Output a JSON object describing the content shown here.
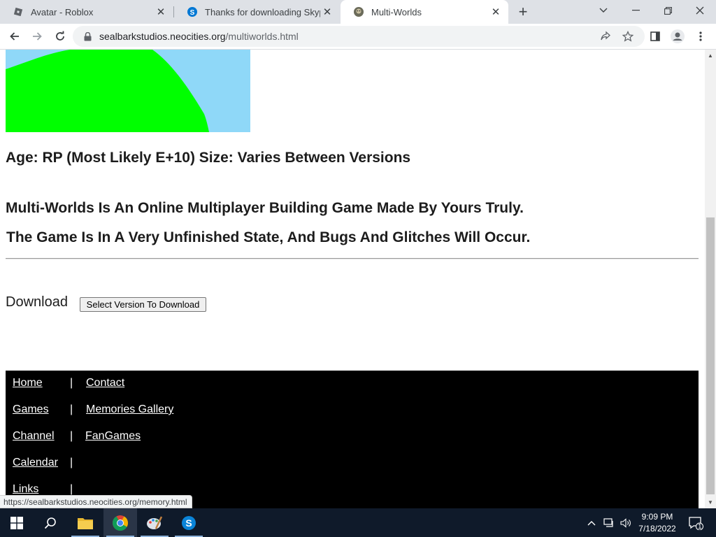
{
  "browser": {
    "tabs": [
      {
        "title": "Avatar - Roblox",
        "icon": "roblox-icon"
      },
      {
        "title": "Thanks for downloading Skype",
        "icon": "skype-icon"
      },
      {
        "title": "Multi-Worlds",
        "icon": "site-favicon",
        "active": true
      }
    ],
    "url_host": "sealbarkstudios.neocities.org",
    "url_path": "/multiworlds.html",
    "status_url": "https://sealbarkstudios.neocities.org/memory.html"
  },
  "page": {
    "info_line": "Age: RP (Most Likely E+10) Size: Varies Between Versions",
    "description_1": "Multi-Worlds Is An Online Multiplayer Building Game Made By Yours Truly.",
    "description_2": "The Game Is In A Very Unfinished State, And Bugs And Glitches Will Occur.",
    "download_label": "Download",
    "download_button": "Select Version To Download",
    "footer_separator": "|",
    "footer_links": {
      "col1": [
        "Home",
        "Games",
        "Channel",
        "Calendar",
        "Links"
      ],
      "col2": [
        "Contact",
        "Memories Gallery",
        "FanGames"
      ]
    }
  },
  "taskbar": {
    "time": "9:09 PM",
    "date": "7/18/2022",
    "notification_count": "1"
  },
  "colors": {
    "avatar_sky": "#8fd8f8",
    "avatar_shirt": "#00ff00",
    "footer_bg": "#000000",
    "taskbar_bg": "#0f1a2a"
  }
}
